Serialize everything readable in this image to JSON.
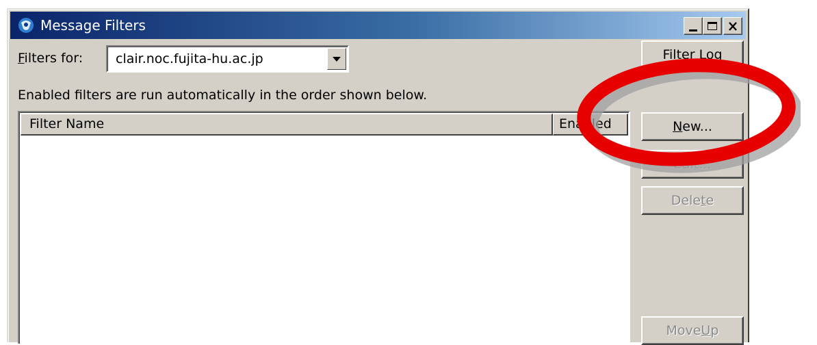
{
  "window": {
    "title": "Message Filters",
    "controls": [
      "minimize-icon",
      "maximize-icon",
      "close-icon"
    ]
  },
  "filters_for": {
    "label_prefix": "F",
    "label_rest": "ilters for:",
    "selected": "clair.noc.fujita-hu.ac.jp"
  },
  "hint_text": "Enabled filters are run automatically in the order shown below.",
  "list": {
    "columns": [
      "Filter Name",
      "Enabled"
    ]
  },
  "buttons": {
    "filter_log": "Filter Log",
    "new_prefix": "N",
    "new_rest": "ew...",
    "edit": "Edit...",
    "delete_a": "Dele",
    "delete_u": "t",
    "delete_b": "e",
    "moveup_a": "Move ",
    "moveup_u": "U",
    "moveup_b": "p"
  },
  "annotation": {
    "color": "#e60000",
    "shape": "red-ellipse"
  }
}
